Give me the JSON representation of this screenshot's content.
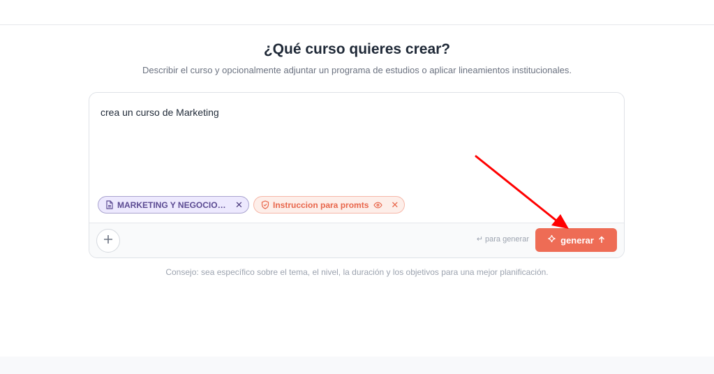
{
  "header": {
    "title": "¿Qué curso quieres crear?",
    "subtitle": "Describir el curso y opcionalmente adjuntar un programa de estudios o aplicar lineamientos institucionales."
  },
  "composer": {
    "prompt_text": "crea un curso de Marketing",
    "attachments": [
      {
        "label": "MARKETING Y NEGOCIOS DIGITALES",
        "icon": "document-icon",
        "color": "#5b4a92"
      },
      {
        "label": "Instruccion para promts",
        "icon": "shield-icon",
        "color": "#e8664b"
      }
    ],
    "remove_glyph": "✕",
    "enter_glyph": "↵",
    "hint_text": "para generar",
    "generate_label": "generar"
  },
  "tip": "Consejo: sea específico sobre el tema, el nivel, la duración y los objetivos para una mejor planificación.",
  "colors": {
    "accent": "#ee6c55",
    "annotation_arrow": "#ff0000"
  }
}
